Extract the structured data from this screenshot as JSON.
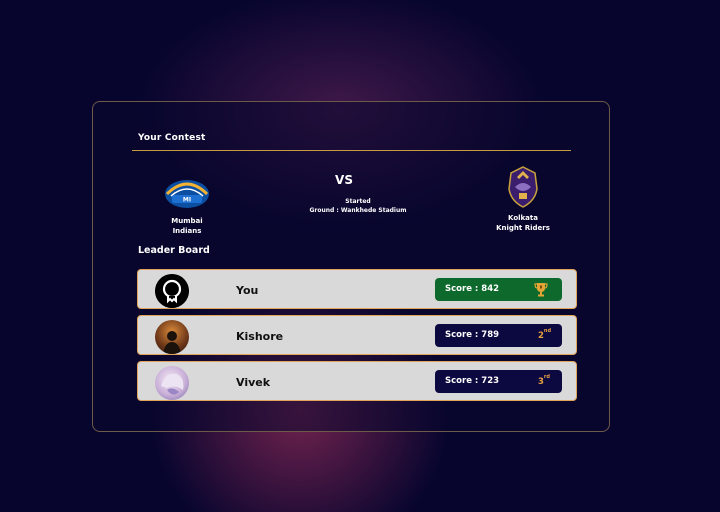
{
  "contest": {
    "title": "Your Contest",
    "vs_label": "VS",
    "status": "Started",
    "ground": "Ground : Wankhede Stadium",
    "team_left": {
      "line1": "Mumbai",
      "line2": "Indians",
      "logo": "mumbai-indians-logo"
    },
    "team_right": {
      "line1": "Kolkata",
      "line2": "Knight Riders",
      "logo": "kkr-logo"
    }
  },
  "leaderboard": {
    "title": "Leader Board",
    "rows": [
      {
        "name": "You",
        "score": "Score : 842",
        "rank_icon": "trophy-icon"
      },
      {
        "name": "Kishore",
        "score": "Score : 789",
        "rank": "2",
        "rank_suffix": "nd"
      },
      {
        "name": "Vivek",
        "score": "Score : 723",
        "rank": "3",
        "rank_suffix": "rd"
      }
    ]
  },
  "colors": {
    "background": "#07052e",
    "accent_gold": "#c79a3e",
    "score_first": "#0e6a2c",
    "score_other": "#0c0940",
    "rank_orange": "#e6a040"
  }
}
